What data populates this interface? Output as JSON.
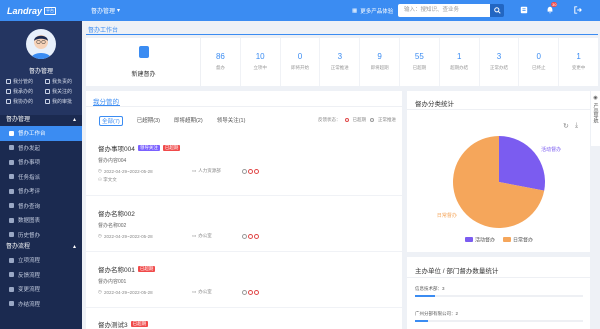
{
  "app": {
    "logo": "Landray",
    "logo_badge": "平台",
    "nav_label": "督办管理"
  },
  "topbar": {
    "experience": "更多产品体验",
    "search_placeholder": "输入：搜知识、查业务",
    "bell_count": "30"
  },
  "sidebar": {
    "username": "督办管理",
    "quick": [
      "我分管的",
      "我负责的",
      "我承办的",
      "我关注的",
      "我协办的",
      "我的审批"
    ],
    "section1": "督办管理",
    "items1": [
      "督办工作台",
      "督办发起",
      "督办事项",
      "任务指派",
      "督办考评",
      "督办查询",
      "数据图表",
      "历史督办"
    ],
    "section2": "督办流程",
    "items2": [
      "立项流程",
      "反馈流程",
      "变更流程",
      "办结流程"
    ]
  },
  "breadcrumb": "督办工作台",
  "stats": {
    "new_label": "新建督办",
    "items": [
      {
        "n": "86",
        "l": "督办"
      },
      {
        "n": "10",
        "l": "立项中"
      },
      {
        "n": "0",
        "l": "即将开始"
      },
      {
        "n": "3",
        "l": "正常推进"
      },
      {
        "n": "9",
        "l": "即将超期"
      },
      {
        "n": "55",
        "l": "已超期"
      },
      {
        "n": "1",
        "l": "超期办结"
      },
      {
        "n": "3",
        "l": "正常办结"
      },
      {
        "n": "0",
        "l": "已终止"
      },
      {
        "n": "1",
        "l": "变更中"
      }
    ]
  },
  "list": {
    "title": "我分管的",
    "filters": [
      "全部(7)",
      "已超期(3)",
      "即将超期(2)",
      "领导关注(1)"
    ],
    "legend_label": "反馈状态：",
    "legend_overdue": "已超期",
    "legend_normal": "正常推进",
    "items": [
      {
        "title": "督办事项004",
        "tags": [
          {
            "t": "领导关注",
            "c": "#7b61ff"
          },
          {
            "t": "已超期",
            "c": "#f04a4a"
          }
        ],
        "sub": "督办内容004",
        "date": "2022-04-29~2022-05-28",
        "dept": "人力资源部",
        "person": "李文文",
        "status": "①②"
      },
      {
        "title": "督办名称002",
        "tags": [],
        "sub": "督办名称002",
        "date": "2022-04-29~2022-05-28",
        "dept": "办公室",
        "person": "",
        "status": "①②"
      },
      {
        "title": "督办名称001",
        "tags": [
          {
            "t": "已超期",
            "c": "#f04a4a"
          }
        ],
        "sub": "督办内容001",
        "date": "2022-04-29~2022-05-28",
        "dept": "办公室",
        "person": "",
        "status": "①②"
      },
      {
        "title": "督办测试3",
        "tags": [
          {
            "t": "已超期",
            "c": "#f04a4a"
          }
        ],
        "sub": "",
        "date": "",
        "dept": "",
        "person": "",
        "status": ""
      }
    ]
  },
  "chart_panel": {
    "title": "督办分类统计"
  },
  "chart_data": {
    "type": "pie",
    "categories": [
      "活动督办",
      "日常督办"
    ],
    "values": [
      28,
      72
    ],
    "colors": [
      "#7b5cf0",
      "#f5a65b"
    ],
    "legend": "bottom"
  },
  "org": {
    "title": "主办单位 / 部门督办数量统计",
    "rows": [
      {
        "label": "信息技术部：",
        "value": "3",
        "frac": 0.12
      },
      {
        "label": "广州分部有限公司：",
        "value": "2",
        "frac": 0.08
      }
    ]
  },
  "rside": {
    "label": "产品导航"
  }
}
